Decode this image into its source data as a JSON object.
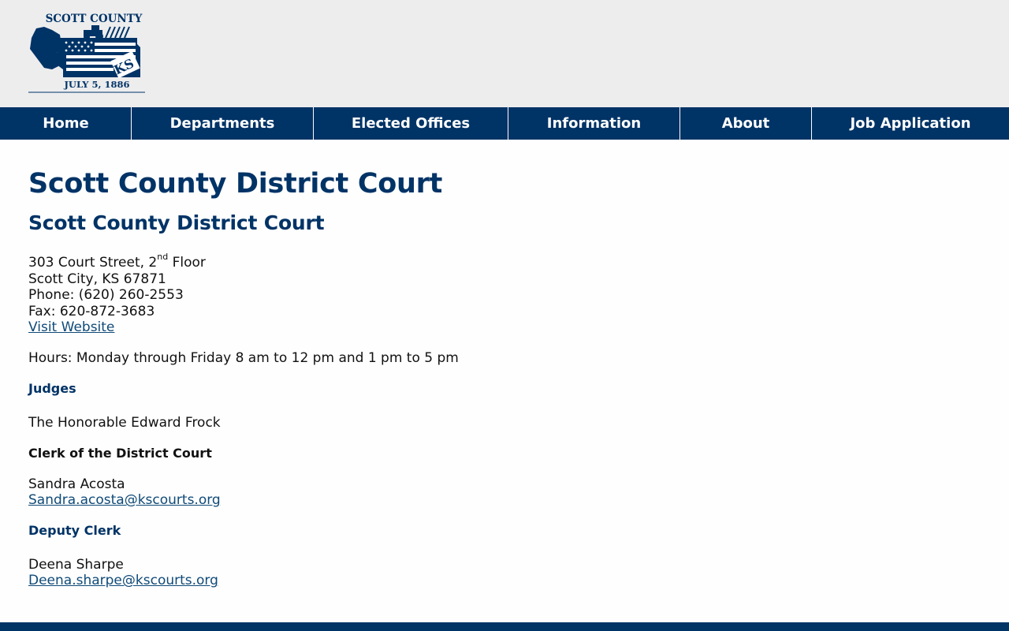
{
  "logo": {
    "title": "SCOTT COUNTY",
    "state": "KS",
    "date": "JULY 5, 1886",
    "colors": {
      "navy": "#003366",
      "white": "#ffffff"
    }
  },
  "nav": {
    "items": [
      {
        "label": "Home"
      },
      {
        "label": "Departments"
      },
      {
        "label": "Elected Offices"
      },
      {
        "label": "Information"
      },
      {
        "label": "About"
      },
      {
        "label": "Job Application"
      }
    ]
  },
  "page": {
    "title": "Scott County District Court",
    "subtitle": "Scott County District Court",
    "address": {
      "street_pre": "303 Court Street, 2",
      "street_sup": "nd",
      "street_post": " Floor",
      "city": "Scott City, KS 67871",
      "phone": "Phone: (620) 260-2553",
      "fax": "Fax: 620-872-3683",
      "website_link": "Visit Website"
    },
    "hours": "Hours:  Monday through Friday 8 am to 12 pm and 1 pm to 5 pm",
    "judges": {
      "heading": "Judges",
      "name": "The Honorable Edward Frock"
    },
    "clerk": {
      "heading": "Clerk of the District Court",
      "name": "Sandra Acosta",
      "email": "Sandra.acosta@kscourts.org"
    },
    "deputy": {
      "heading": "Deputy Clerk",
      "name": "Deena Sharpe",
      "email": "Deena.sharpe@kscourts.org"
    }
  },
  "colors": {
    "header_bg": "#ededee",
    "navy": "#003366",
    "link": "#0f4a78"
  }
}
